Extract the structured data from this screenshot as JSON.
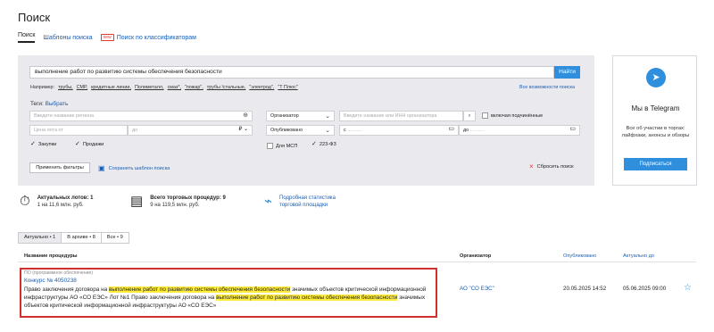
{
  "page": {
    "title": "Поиск"
  },
  "tabs": {
    "search": "Поиск",
    "templates": "Шаблоны поиска",
    "new_badge": "new",
    "classifiers": "Поиск по классификаторам"
  },
  "search": {
    "query": "выполнение работ по развитию системы обеспечения безопасности",
    "button": "Найти",
    "examples_label": "Например:",
    "examples": [
      "трубы,",
      "СМР,",
      "кредитные линии,",
      "Полиметалл,",
      "смаз*,",
      "\"пожар\",",
      "трубы !стальные,",
      "\"электрод\",",
      "\"Т Плюс\""
    ],
    "advanced": "Все возможности поиска"
  },
  "tags": {
    "label": "Теги:",
    "select": "Выбрать"
  },
  "filters": {
    "region_ph": "Введите название региона",
    "organizer_sel": "Организатор",
    "organizer_ph": "Введите название или ИНН организатора",
    "include_sub": "включая подчинённые",
    "price_ph": "Цена лота от",
    "price_to": "до",
    "currency": "₽",
    "published_sel": "Опубликовано",
    "date_from": "с",
    "date_to": "до",
    "purchases": "Закупки",
    "sales": "Продажи",
    "msp": "Для МСП",
    "fz223": "223-ФЗ",
    "apply": "Применить фильтры",
    "save_template": "Сохранить шаблон поиска",
    "reset": "Сбросить поиск"
  },
  "telegram": {
    "title": "Мы в Telegram",
    "text": "Все об участии в торгах: лайфхаки, анонсы и обзоры",
    "button": "Подписаться"
  },
  "stats": {
    "lots_title": "Актуальных лотов: 1",
    "lots_sub": "1 на 11,6 млн. руб.",
    "procs_title": "Всего торговых процедур: 9",
    "procs_sub": "9 на 119,5 млн. руб.",
    "link1": "Подробная статистика",
    "link2": "торговой площадки"
  },
  "segments": [
    "Актуально • 1",
    "В архиве • 8",
    "Все • 9"
  ],
  "table": {
    "headers": {
      "name": "Название процедуры",
      "org": "Организатор",
      "pub": "Опубликовано",
      "till": "Актуально до"
    },
    "row": {
      "type": "ПО (программное обеспечение)",
      "number": "Конкурс № 4050238",
      "d1": "Право заключения договора на ",
      "h1": "выполнение работ по развитию системы обеспечения безопасности",
      "d2": " значимых объектов критической информационной инфраструктуры АО «СО ЕЭС» Лот №1 Право заключения договора на ",
      "h2": "выполнение работ по развитию системы обеспечения безопасности",
      "d3": " значимых объектов критической информационной инфраструктуры АО «СО ЕЭС»",
      "org": "АО \"СО ЕЭС\"",
      "published": "20.05.2025 14:52",
      "till": "05.06.2025 09:00"
    }
  },
  "colors": {
    "accent": "#2f8fdd",
    "link": "#1a5fb4",
    "highlight": "#ffec3d",
    "frame": "#d32f2f"
  }
}
